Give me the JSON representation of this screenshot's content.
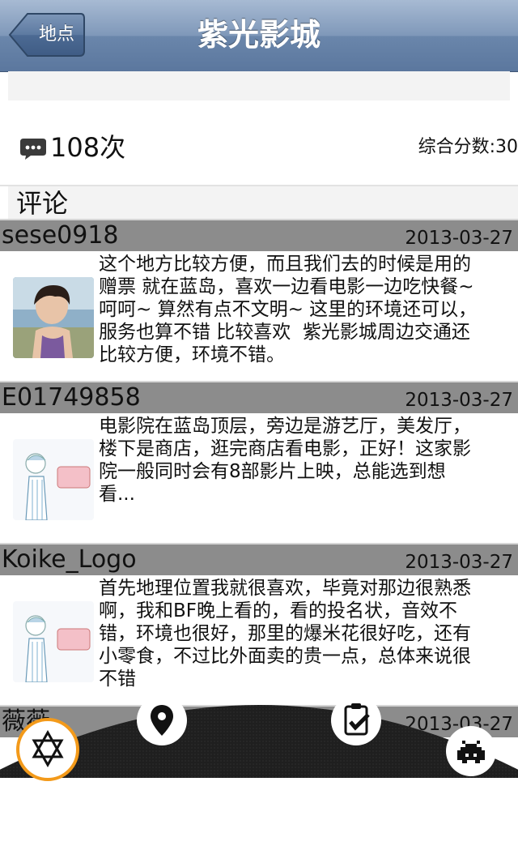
{
  "nav": {
    "back_label": "地点",
    "title": "紫光影城"
  },
  "stats": {
    "comment_count": "108次",
    "score_label": "综合分数:30"
  },
  "section": {
    "comments_heading": "评论"
  },
  "reviews": [
    {
      "user": "sese0918",
      "date": "2013-03-27",
      "text": "这个地方比较方便，而且我们去的时候是用的\n赠票 就在蓝岛，喜欢一边看电影一边吃快餐~\n呵呵~ 算然有点不文明~ 这里的环境还可以，\n服务也算不错 比较喜欢  紫光影城周边交通还\n比较方便，环境不错。"
    },
    {
      "user": "E01749858",
      "date": "2013-03-27",
      "text": "电影院在蓝岛顶层，旁边是游艺厅，美发厅，\n楼下是商店，逛完商店看电影，正好！这家影\n院一般同时会有8部影片上映，总能选到想\n看..."
    },
    {
      "user": "Koike_Logo",
      "date": "2013-03-27",
      "text": "首先地理位置我就很喜欢，毕竟对那边很熟悉\n啊，我和BF晚上看的，看的投名状，音效不\n错，环境也很好，那里的爆米花很好吃，还有\n小零食，不过比外面卖的贵一点，总体来说很\n不错"
    },
    {
      "user": "薇薇",
      "date": "2013-03-27",
      "text": ""
    }
  ],
  "tabs": [
    {
      "icon": "star-of-david-icon"
    },
    {
      "icon": "location-pin-icon"
    },
    {
      "icon": "clipboard-check-icon"
    },
    {
      "icon": "space-invader-icon"
    }
  ],
  "colors": {
    "navbar": "#6a86ab",
    "review_header": "#8c8c8c",
    "tabbar": "#1e1e1e",
    "active_tab_ring": "#f39a1a"
  }
}
